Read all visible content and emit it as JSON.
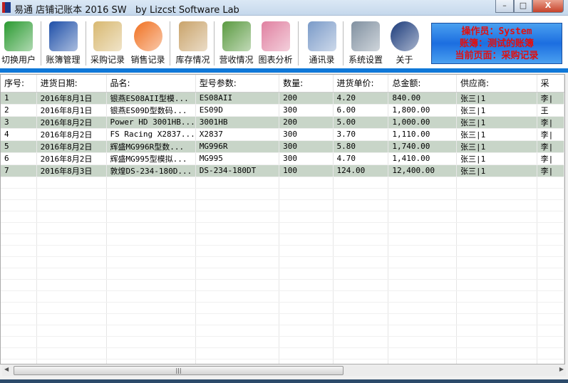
{
  "window": {
    "title": "易通 店铺记账本 2016 SW   by Lizcst Software Lab",
    "minimize": "–",
    "maximize": "□",
    "close": "X"
  },
  "toolbar": {
    "items": [
      {
        "label": "切换用户",
        "icon": "switch-user-icon",
        "color": "#2a9a30"
      },
      {
        "label": "账簿管理",
        "icon": "ledger-book-icon",
        "color": "#1e4fa8"
      },
      {
        "label": "采购记录",
        "icon": "purchase-box-icon",
        "color": "#d8b870",
        "selected": true
      },
      {
        "label": "销售记录",
        "icon": "dollar-coin-icon",
        "color": "#f07020"
      },
      {
        "label": "库存情况",
        "icon": "inventory-box-icon",
        "color": "#c9a36a"
      },
      {
        "label": "营收情况",
        "icon": "revenue-money-icon",
        "color": "#5a9a40"
      },
      {
        "label": "图表分析",
        "icon": "chart-icon",
        "color": "#e080a0"
      },
      {
        "label": "通讯录",
        "icon": "address-book-icon",
        "color": "#7a9ac8"
      },
      {
        "label": "系统设置",
        "icon": "tools-icon",
        "color": "#8090a0"
      },
      {
        "label": "关于",
        "icon": "info-icon",
        "color": "#1a3a7a"
      }
    ]
  },
  "info": {
    "operator": "操作员：System",
    "ledger": "账簿：测试的账簿",
    "page": "当前页面：采购记录"
  },
  "table": {
    "columns": [
      "序号:",
      "进货日期:",
      "品名:",
      "型号参数:",
      "数量:",
      "进货单价:",
      "总金额:",
      "供应商:",
      "采"
    ],
    "rows": [
      [
        "1",
        "2016年8月1日",
        "银燕ES08AII型模...",
        "ES08AII",
        "200",
        "4.20",
        "840.00",
        "张三|1",
        "李|"
      ],
      [
        "2",
        "2016年8月1日",
        "银燕ES09D型数码...",
        "ES09D",
        "300",
        "6.00",
        "1,800.00",
        "张三|1",
        "王"
      ],
      [
        "3",
        "2016年8月2日",
        "Power HD 3001HB...",
        "3001HB",
        "200",
        "5.00",
        "1,000.00",
        "张三|1",
        "李|"
      ],
      [
        "4",
        "2016年8月2日",
        "FS Racing X2837...",
        "X2837",
        "300",
        "3.70",
        "1,110.00",
        "张三|1",
        "李|"
      ],
      [
        "5",
        "2016年8月2日",
        "辉盛MG996R型数...",
        "MG996R",
        "300",
        "5.80",
        "1,740.00",
        "张三|1",
        "李|"
      ],
      [
        "6",
        "2016年8月2日",
        "辉盛MG995型模拟...",
        "MG995",
        "300",
        "4.70",
        "1,410.00",
        "张三|1",
        "李|"
      ],
      [
        "7",
        "2016年8月3日",
        "敦煌DS-234-180D...",
        "DS-234-180DT",
        "100",
        "124.00",
        "12,400.00",
        "张三|1",
        "李|"
      ]
    ]
  },
  "scrollbar": {
    "grip": "|||",
    "left": "◀",
    "right": "▶"
  }
}
